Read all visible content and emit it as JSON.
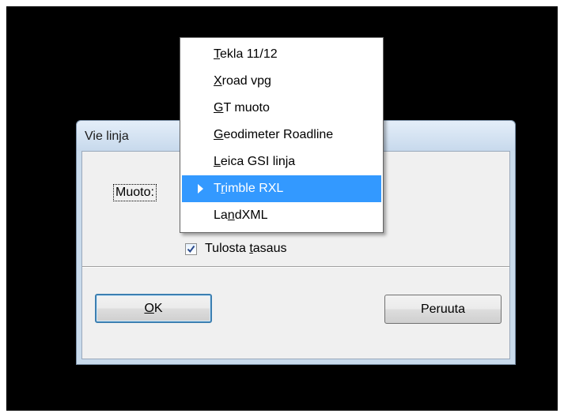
{
  "dialog": {
    "title": "Vie linja",
    "muoto_label": "Muoto:",
    "checkbox": {
      "label_before": "Tulosta ",
      "label_underlined": "t",
      "label_after": "asaus",
      "checked": true
    },
    "ok_button": {
      "underlined": "O",
      "rest": "K"
    },
    "cancel_button": "Peruuta"
  },
  "dropdown": {
    "selected_index": 5,
    "items": [
      {
        "underlined": "T",
        "rest": "ekla 11/12"
      },
      {
        "underlined": "X",
        "rest": "road vpg"
      },
      {
        "underlined": "G",
        "rest": "T muoto"
      },
      {
        "underlined": "G",
        "rest": "eodimeter Roadline"
      },
      {
        "underlined": "L",
        "rest": "eica GSI linja"
      },
      {
        "before": "T",
        "underlined": "r",
        "rest": "imble RXL"
      },
      {
        "before": "La",
        "underlined": "n",
        "rest": "dXML"
      }
    ]
  },
  "colors": {
    "background": "#000000",
    "selection": "#3399ff",
    "dialog_frame": "#c9dbec",
    "client_area": "#f0f0f0"
  }
}
